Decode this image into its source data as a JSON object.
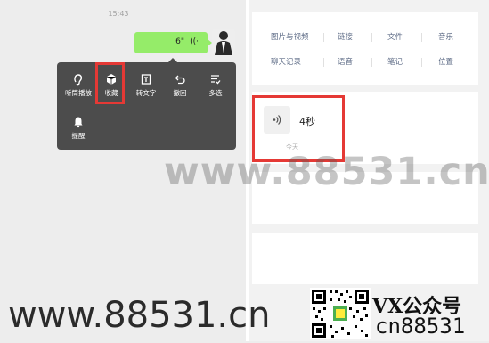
{
  "chat": {
    "time": "15:43",
    "voice_duration": "6\"",
    "menu": [
      {
        "label": "听筒播放",
        "icon": "ear-icon"
      },
      {
        "label": "收藏",
        "icon": "cube-icon"
      },
      {
        "label": "转文字",
        "icon": "text-icon"
      },
      {
        "label": "撤回",
        "icon": "undo-icon"
      },
      {
        "label": "多选",
        "icon": "multiselect-icon"
      },
      {
        "label": "提醒",
        "icon": "bell-icon"
      }
    ]
  },
  "favorites": {
    "filters_row1": [
      "图片与视频",
      "链接",
      "文件",
      "音乐"
    ],
    "filters_row2": [
      "聊天记录",
      "语音",
      "笔记",
      "位置"
    ],
    "item": {
      "duration": "4秒",
      "date": "今天"
    }
  },
  "watermark": {
    "center": "www.88531.cn",
    "bottom": "www.88531.cn",
    "vx": "VX公众号",
    "id": "cn88531"
  },
  "colors": {
    "highlight": "#e53935",
    "bubble": "#95ec69",
    "menu_bg": "#4c4c4c",
    "filter_text": "#5d6b86"
  }
}
